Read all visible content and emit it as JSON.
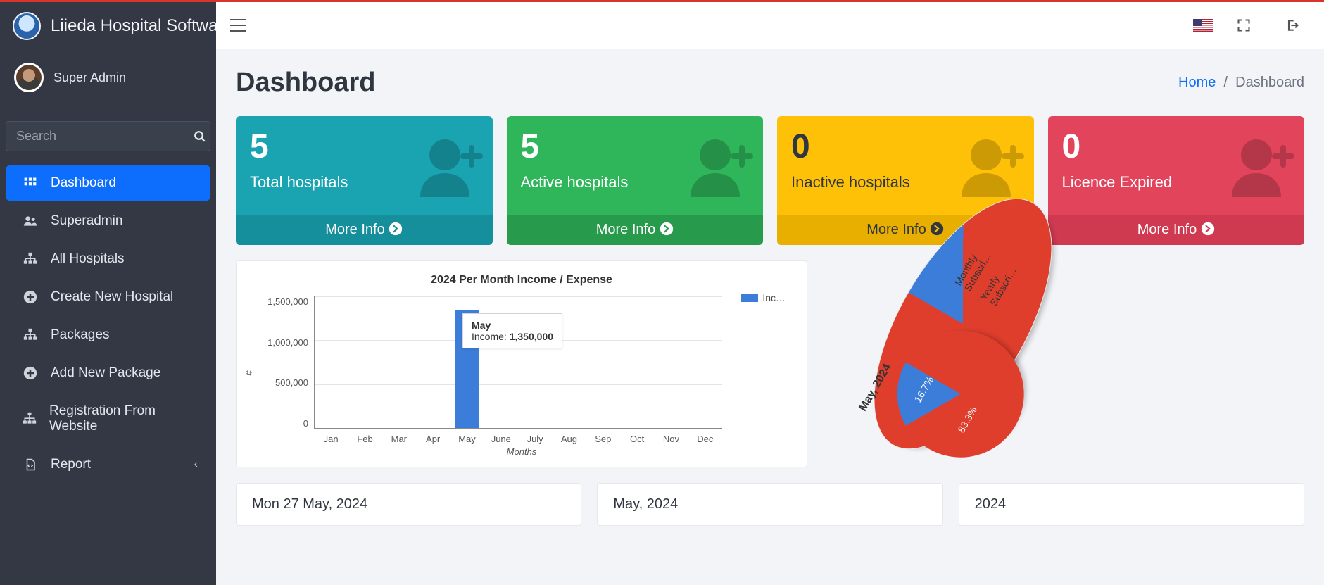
{
  "brand": {
    "name": "Liieda Hospital Softwa"
  },
  "user": {
    "name": "Super Admin"
  },
  "search": {
    "placeholder": "Search"
  },
  "nav": {
    "items": [
      {
        "label": "Dashboard",
        "icon": "grid",
        "active": true
      },
      {
        "label": "Superadmin",
        "icon": "users",
        "active": false
      },
      {
        "label": "All Hospitals",
        "icon": "sitemap",
        "active": false
      },
      {
        "label": "Create New Hospital",
        "icon": "plus",
        "active": false
      },
      {
        "label": "Packages",
        "icon": "sitemap",
        "active": false
      },
      {
        "label": "Add New Package",
        "icon": "plus",
        "active": false
      },
      {
        "label": "Registration From Website",
        "icon": "sitemap",
        "active": false
      },
      {
        "label": "Report",
        "icon": "report",
        "active": false,
        "caret": true
      }
    ]
  },
  "page": {
    "title": "Dashboard",
    "breadcrumb": {
      "home": "Home",
      "sep": "/",
      "current": "Dashboard"
    }
  },
  "stats": [
    {
      "value": "5",
      "label": "Total hospitals",
      "more": "More Info",
      "color": "teal"
    },
    {
      "value": "5",
      "label": "Active hospitals",
      "more": "More Info",
      "color": "green"
    },
    {
      "value": "0",
      "label": "Inactive hospitals",
      "more": "More Info",
      "color": "yellow"
    },
    {
      "value": "0",
      "label": "Licence Expired",
      "more": "More Info",
      "color": "redc"
    }
  ],
  "chart_data": {
    "type": "bar",
    "title": "2024 Per Month Income / Expense",
    "xlabel": "Months",
    "ylabel": "#",
    "categories": [
      "Jan",
      "Feb",
      "Mar",
      "Apr",
      "May",
      "June",
      "July",
      "Aug",
      "Sep",
      "Oct",
      "Nov",
      "Dec"
    ],
    "series": [
      {
        "name": "Inc…",
        "values": [
          0,
          0,
          0,
          0,
          1350000,
          0,
          0,
          0,
          0,
          0,
          0,
          0
        ],
        "color": "#3b7dd8"
      }
    ],
    "ylim": [
      0,
      1500000
    ],
    "yticks": [
      "1,500,000",
      "1,000,000",
      "500,000",
      "0"
    ],
    "tooltip": {
      "month": "May",
      "metric": "Income:",
      "value": "1,350,000"
    }
  },
  "pie": {
    "title": "May, 2024",
    "type": "pie",
    "slices": [
      {
        "label": "Monthly Subscri…",
        "pct": 16.7,
        "pct_label": "16.7%",
        "color": "#3b7dd8"
      },
      {
        "label": "Yearly Subscri…",
        "pct": 83.3,
        "pct_label": "83.3%",
        "color": "#e03e2d"
      }
    ]
  },
  "bottom_panels": [
    {
      "title": "Mon 27 May, 2024"
    },
    {
      "title": "May, 2024"
    },
    {
      "title": "2024"
    }
  ]
}
